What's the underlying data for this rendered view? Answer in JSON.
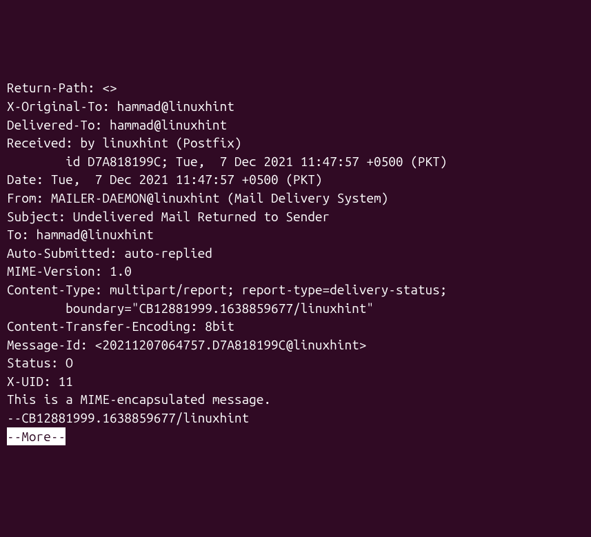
{
  "lines": [
    "Return-Path: <>",
    "X-Original-To: hammad@linuxhint",
    "Delivered-To: hammad@linuxhint",
    "Received: by linuxhint (Postfix)",
    "        id D7A818199C; Tue,  7 Dec 2021 11:47:57 +0500 (PKT)",
    "Date: Tue,  7 Dec 2021 11:47:57 +0500 (PKT)",
    "From: MAILER-DAEMON@linuxhint (Mail Delivery System)",
    "Subject: Undelivered Mail Returned to Sender",
    "To: hammad@linuxhint",
    "Auto-Submitted: auto-replied",
    "MIME-Version: 1.0",
    "Content-Type: multipart/report; report-type=delivery-status;",
    "        boundary=\"CB12881999.1638859677/linuxhint\"",
    "Content-Transfer-Encoding: 8bit",
    "Message-Id: <20211207064757.D7A818199C@linuxhint>",
    "Status: O",
    "X-UID: 11",
    "",
    "This is a MIME-encapsulated message.",
    "",
    "--CB12881999.1638859677/linuxhint"
  ],
  "more_prompt": "--More--"
}
